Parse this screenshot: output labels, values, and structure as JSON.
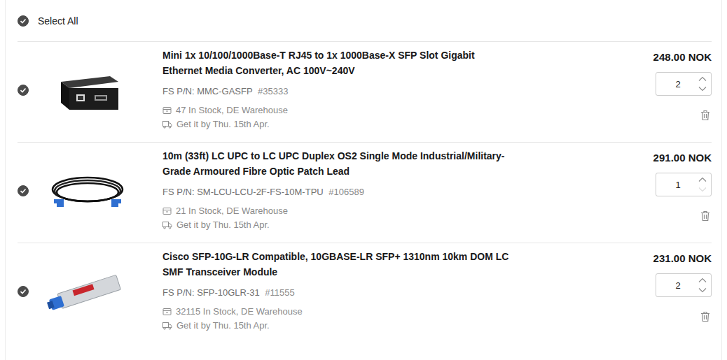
{
  "select_all": {
    "label": "Select All",
    "checked": true
  },
  "items": [
    {
      "kind": "converter",
      "checked": true,
      "title": "Mini 1x 10/100/1000Base-T RJ45 to 1x 1000Base-X SFP Slot Gigabit Ethernet Media Converter, AC 100V~240V",
      "pn_label": "FS P/N:",
      "pn": "MMC-GASFP",
      "id": "#35333",
      "stock": "47 In Stock, DE Warehouse",
      "delivery": "Get it by Thu. 15th Apr.",
      "price": "248.00 NOK",
      "quantity": "2",
      "increase_disabled": false,
      "decrease_disabled": false
    },
    {
      "kind": "cable",
      "checked": true,
      "title": "10m (33ft) LC UPC to LC UPC Duplex OS2 Single Mode Industrial/Military-Grade Armoured Fibre Optic Patch Lead",
      "pn_label": "FS P/N:",
      "pn": "SM-LCU-LCU-2F-FS-10M-TPU",
      "id": "#106589",
      "stock": "21 In Stock, DE Warehouse",
      "delivery": "Get it by Thu. 15th Apr.",
      "price": "291.00 NOK",
      "quantity": "1",
      "increase_disabled": false,
      "decrease_disabled": true
    },
    {
      "kind": "module",
      "checked": true,
      "title": "Cisco SFP-10G-LR Compatible, 10GBASE-LR SFP+ 1310nm 10km DOM LC SMF Transceiver Module",
      "pn_label": "FS P/N:",
      "pn": "SFP-10GLR-31",
      "id": "#11555",
      "stock": "32115 In Stock, DE Warehouse",
      "delivery": "Get it by Thu. 15th Apr.",
      "price": "231.00 NOK",
      "quantity": "2",
      "increase_disabled": false,
      "decrease_disabled": false
    }
  ]
}
